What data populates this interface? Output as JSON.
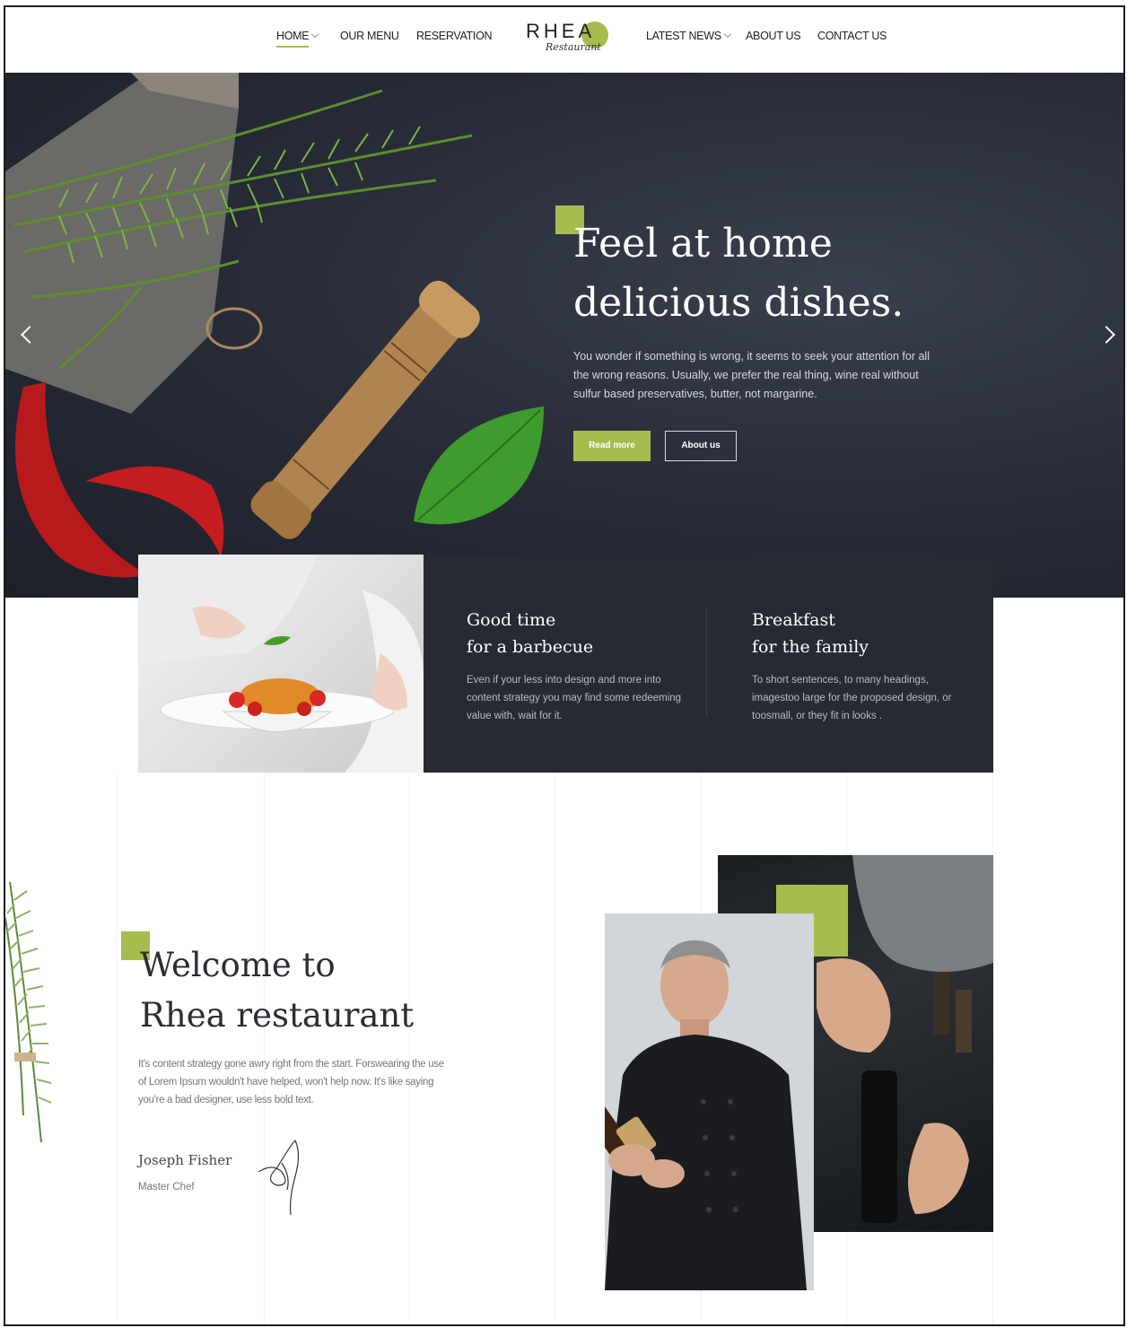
{
  "nav": {
    "left_items": [
      {
        "label": "HOME",
        "active": true,
        "has_dropdown": true
      },
      {
        "label": "OUR MENU",
        "active": false,
        "has_dropdown": false
      },
      {
        "label": "RESERVATION",
        "active": false,
        "has_dropdown": false
      }
    ],
    "right_items": [
      {
        "label": "LATEST NEWS",
        "active": false,
        "has_dropdown": true
      },
      {
        "label": "ABOUT US",
        "active": false,
        "has_dropdown": false
      },
      {
        "label": "CONTACT US",
        "active": false,
        "has_dropdown": false
      }
    ],
    "logo": {
      "word": "RHEA",
      "sub": "Restaurant"
    }
  },
  "hero": {
    "title_line1": "Feel at home",
    "title_line2": "delicious dishes.",
    "text": "You wonder if something is wrong, it seems to seek your attention for all the wrong reasons. Usually, we prefer the real thing, wine real without sulfur based preservatives, butter, not margarine.",
    "primary_button": "Read more",
    "secondary_button": "About us"
  },
  "features": [
    {
      "title_line1": "Good time",
      "title_line2": "for a barbecue",
      "text": "Even if your less into design and more into content strategy you may find some redeeming value with, wait for it."
    },
    {
      "title_line1": "Breakfast",
      "title_line2": "for the family",
      "text": "To short sentences, to many headings, imagestoo large for the proposed design, or toosmall, or they fit in looks ."
    }
  ],
  "welcome": {
    "title_line1": "Welcome to",
    "title_line2": "Rhea restaurant",
    "text": "It's content strategy gone awry right from the start. Forswearing the use of Lorem Ipsum wouldn't have helped, won't help now. It's like saying you're a bad designer, use less bold text.",
    "chef_name": "Joseph Fisher",
    "chef_role": "Master Chef"
  },
  "colors": {
    "accent": "#a5bd4e",
    "dark": "#272a33",
    "hero_bg": "#262a35"
  }
}
